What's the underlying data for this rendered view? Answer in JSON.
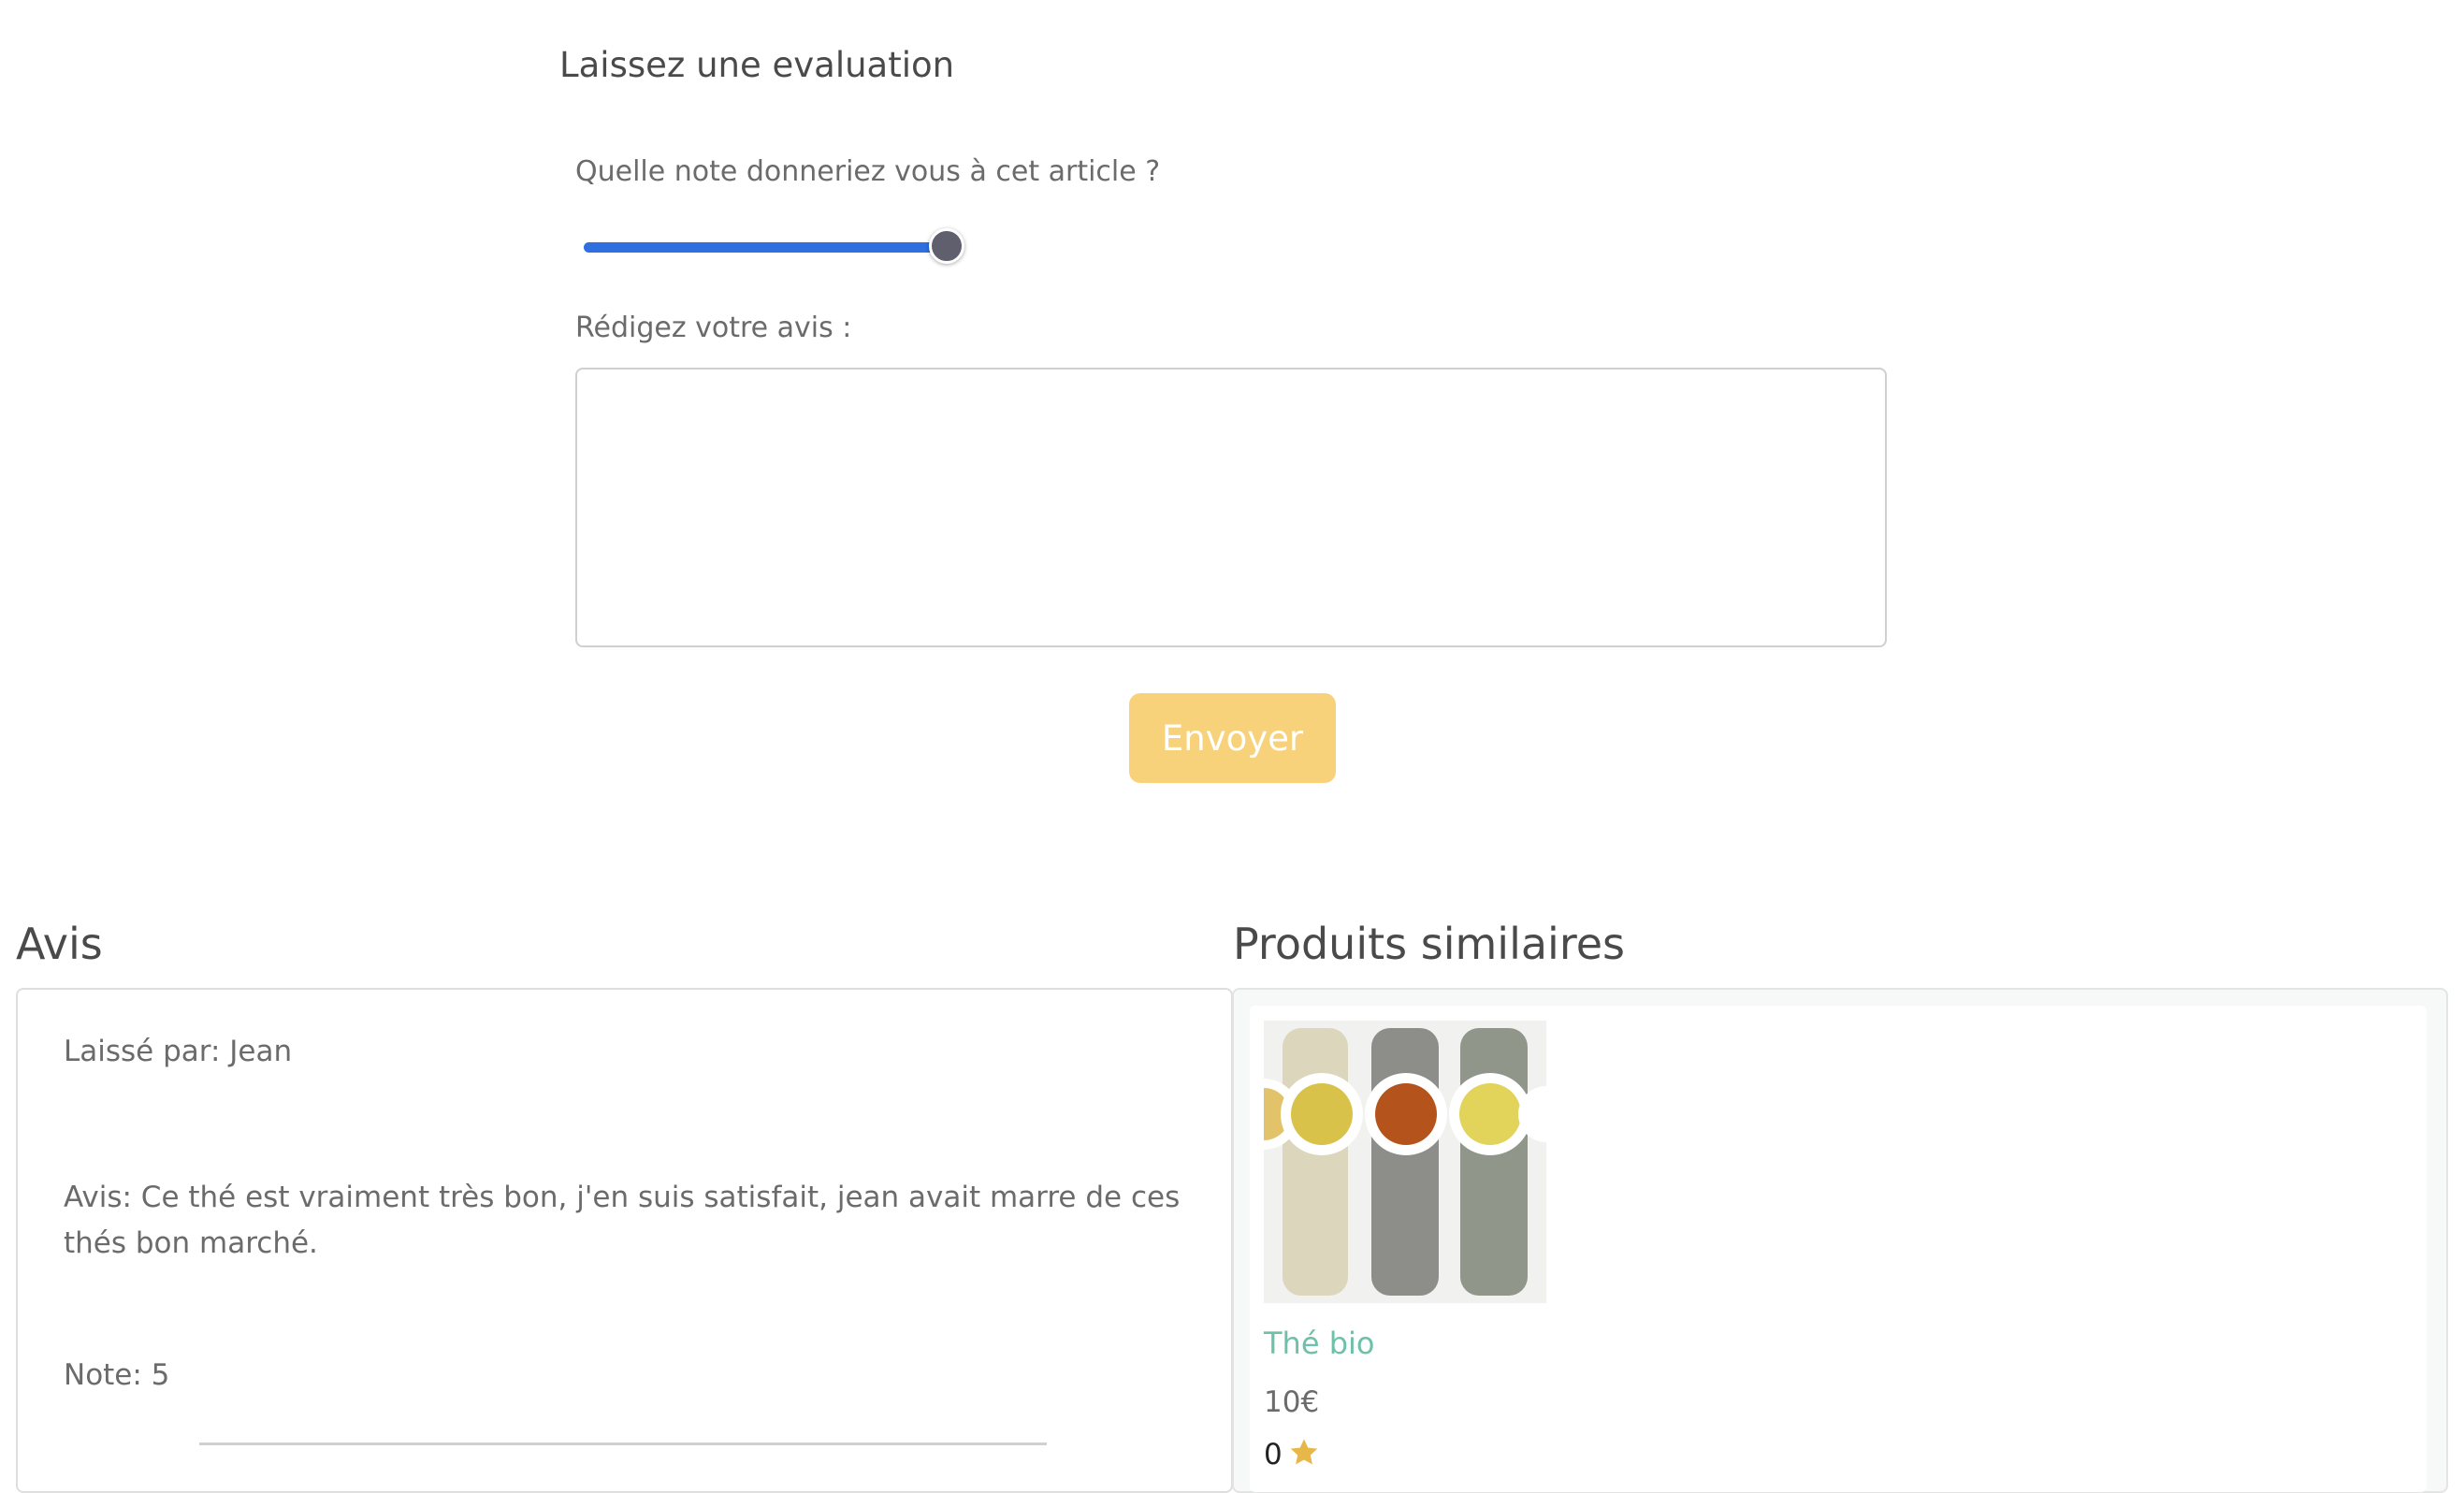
{
  "review_form": {
    "title": "Laissez une evaluation",
    "rating_question": "Quelle note donneriez vous à cet article ?",
    "rating_slider": {
      "min": 0,
      "max": 5,
      "value": 5,
      "fill_color": "#2f6fe0"
    },
    "review_label": "Rédigez votre avis :",
    "review_value": "",
    "submit_label": "Envoyer",
    "submit_color": "#f7d27a"
  },
  "reviews": {
    "title": "Avis",
    "items": [
      {
        "author": "Laissé par: Jean",
        "text": "Avis: Ce thé est vraiment très bon, j'en suis satisfait, jean avait marre de ces thés bon marché.",
        "note": "Note: 5"
      }
    ]
  },
  "similar_products": {
    "title": "Produits similaires",
    "items": [
      {
        "name": "Thé bio",
        "price": "10€",
        "rating": "0",
        "image_icon": "tea-cups-photo",
        "name_color": "#6fc0a8",
        "star_color": "#e8b74a"
      }
    ]
  }
}
